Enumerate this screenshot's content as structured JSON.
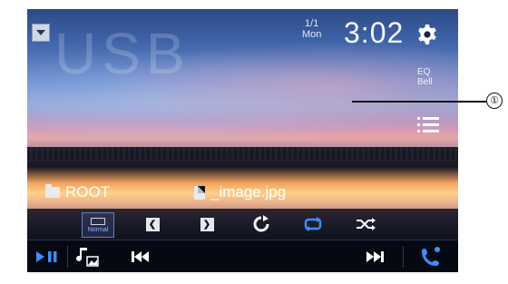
{
  "source": {
    "watermark": "USB"
  },
  "clock": {
    "date": "1/1",
    "day": "Mon",
    "time": "3:02"
  },
  "status": {
    "eq_label": "EQ",
    "eq_sub": "Bell"
  },
  "browser": {
    "folder": "ROOT",
    "file": "_image.jpg"
  },
  "toolbar": {
    "display_mode": "Normal"
  },
  "callout": {
    "number": "①"
  },
  "colors": {
    "accent": "#3f8cff",
    "text": "#ffffff",
    "toolbar_bg": "#080c18"
  },
  "icons": {
    "menu": "chevron-down-icon",
    "settings": "gear-icon",
    "list": "list-icon",
    "prev_file": "previous-file-icon",
    "next_file": "next-file-icon",
    "rotate": "rotate-icon",
    "repeat": "repeat-icon",
    "shuffle": "shuffle-icon",
    "play_pause": "play-pause-icon",
    "media_switch": "media-switch-icon",
    "prev_track": "previous-track-icon",
    "next_track": "next-track-icon",
    "phone": "phone-icon"
  }
}
